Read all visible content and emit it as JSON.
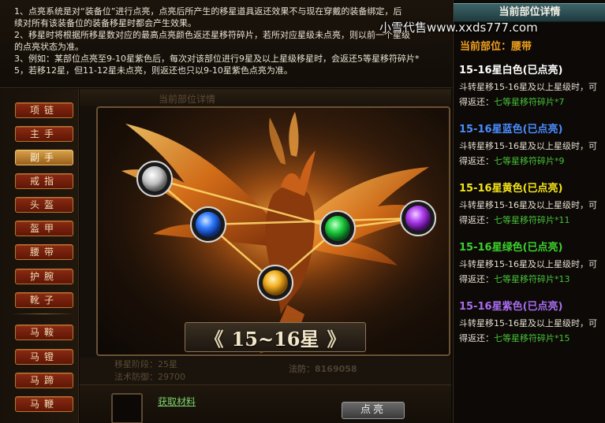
{
  "info": {
    "lines": [
      "1、点亮系统是对“装备位”进行点亮，点亮后所产生的移星道具返还效果不与现在穿戴的装备绑定，后",
      "续对所有该装备位的装备移星时都会产生效果。",
      "2、移星时将根据所移星数对应的最高点亮颜色返还星移符碎片，若所对应星级未点亮，则以前一个星级",
      "的点亮状态为准。",
      "3、例如：某部位点亮至9-10星紫色后，每次对该部位进行9星及以上星级移星时，会返还5等星移符碎片*",
      "5，若移12星，但11-12星未点亮，则返还也只以9-10星紫色点亮为准。"
    ]
  },
  "categories": [
    {
      "label": "项链",
      "active": false
    },
    {
      "label": "主手",
      "active": false
    },
    {
      "label": "副手",
      "active": true
    },
    {
      "label": "戒指",
      "active": false
    },
    {
      "label": "头盔",
      "active": false
    },
    {
      "label": "盔甲",
      "active": false
    },
    {
      "label": "腰带",
      "active": false
    },
    {
      "label": "护腕",
      "active": false
    },
    {
      "label": "靴子",
      "active": false
    },
    {
      "label": "马鞍",
      "active": false
    },
    {
      "label": "马镫",
      "active": false
    },
    {
      "label": "马蹄",
      "active": false
    },
    {
      "label": "马鞭",
      "active": false
    }
  ],
  "center": {
    "header_ghost": "当前部位详情",
    "banner": {
      "left": "《",
      "text": "15~16星",
      "right": "》"
    },
    "gems": [
      {
        "name": "white",
        "color": "#e8e8e8"
      },
      {
        "name": "blue",
        "color": "#2f7bff"
      },
      {
        "name": "yellow",
        "color": "#f2b020"
      },
      {
        "name": "green",
        "color": "#1fd040"
      },
      {
        "name": "purple",
        "color": "#b040f0"
      }
    ],
    "stats": {
      "left1": "移星阶段：25星",
      "left2": "法术防御：29700",
      "right": "法防：8169058"
    },
    "material_link": "获取材料",
    "light_button": "点亮"
  },
  "right": {
    "header": "当前部位详情",
    "watermark": "小雪代售www.xxds777.com",
    "current_label": "当前部位：",
    "current_value": "腰带",
    "tiers": [
      {
        "title": "15-16星白色(已点亮)",
        "color": "#ffffff",
        "desc": "斗转星移15-16星及以上星级时，可",
        "reward_label": "得返还：",
        "reward_item": "七等星移符碎片*7"
      },
      {
        "title": "15-16星蓝色(已点亮)",
        "color": "#4a8cff",
        "desc": "斗转星移15-16星及以上星级时，可",
        "reward_label": "得返还：",
        "reward_item": "七等星移符碎片*9"
      },
      {
        "title": "15-16星黄色(已点亮)",
        "color": "#f2e21a",
        "desc": "斗转星移15-16星及以上星级时，可",
        "reward_label": "得返还：",
        "reward_item": "七等星移符碎片*11"
      },
      {
        "title": "15-16星绿色(已点亮)",
        "color": "#3cd02c",
        "desc": "斗转星移15-16星及以上星级时，可",
        "reward_label": "得返还：",
        "reward_item": "七等星移符碎片*13"
      },
      {
        "title": "15-16星紫色(已点亮)",
        "color": "#a86cf0",
        "desc": "斗转星移15-16星及以上星级时，可",
        "reward_label": "得返还：",
        "reward_item": "七等星移符碎片*15"
      }
    ]
  }
}
